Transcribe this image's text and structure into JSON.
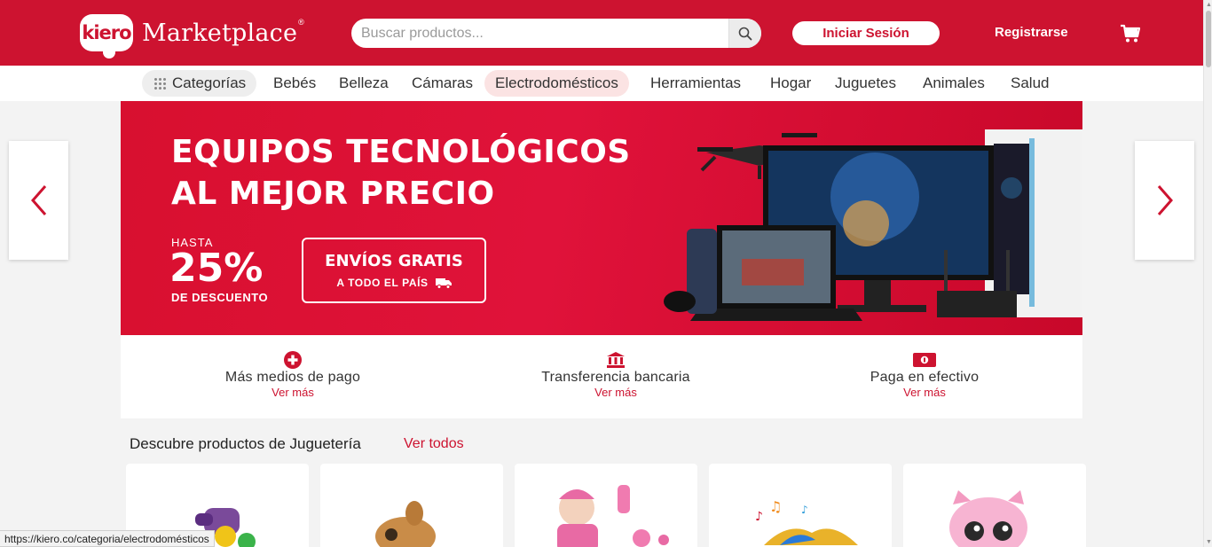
{
  "header": {
    "logo_badge": "kiero",
    "logo_text": "Marketplace",
    "logo_reg": "®",
    "search_placeholder": "Buscar productos...",
    "login_label": "Iniciar Sesión",
    "register_label": "Registrarse",
    "brand_color": "#cd1330"
  },
  "nav": {
    "categories_label": "Categorías",
    "items": [
      {
        "label": "Bebés"
      },
      {
        "label": "Belleza"
      },
      {
        "label": "Cámaras"
      },
      {
        "label": "Electrodomésticos"
      },
      {
        "label": "Herramientas"
      },
      {
        "label": "Hogar"
      },
      {
        "label": "Juguetes"
      },
      {
        "label": "Animales"
      },
      {
        "label": "Salud"
      }
    ],
    "active": "Electrodomésticos"
  },
  "banner": {
    "title_line1": "EQUIPOS TECNOLÓGICOS",
    "title_line2": "AL MEJOR PRECIO",
    "hasta": "HASTA",
    "discount": "25%",
    "discount_label": "DE DESCUENTO",
    "shipping_title": "ENVÍOS GRATIS",
    "shipping_sub": "A TODO EL PAÍS"
  },
  "payments": [
    {
      "title": "Más medios de pago",
      "link": "Ver más",
      "icon": "plus-circle-icon"
    },
    {
      "title": "Transferencia bancaria",
      "link": "Ver más",
      "icon": "bank-icon"
    },
    {
      "title": "Paga en efectivo",
      "link": "Ver más",
      "icon": "cash-icon"
    }
  ],
  "products": {
    "section_title": "Descubre productos de Juguetería",
    "see_all": "Ver todos"
  },
  "status_url": "https://kiero.co/categoria/electrodomésticos"
}
